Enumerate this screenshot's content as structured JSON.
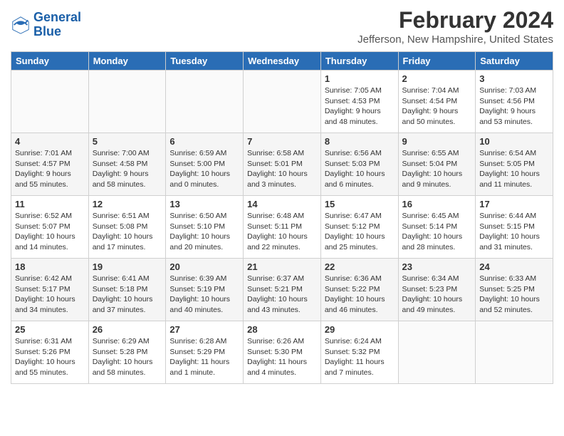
{
  "logo": {
    "line1": "General",
    "line2": "Blue"
  },
  "title": "February 2024",
  "subtitle": "Jefferson, New Hampshire, United States",
  "days_of_week": [
    "Sunday",
    "Monday",
    "Tuesday",
    "Wednesday",
    "Thursday",
    "Friday",
    "Saturday"
  ],
  "weeks": [
    [
      {
        "day": "",
        "info": ""
      },
      {
        "day": "",
        "info": ""
      },
      {
        "day": "",
        "info": ""
      },
      {
        "day": "",
        "info": ""
      },
      {
        "day": "1",
        "info": "Sunrise: 7:05 AM\nSunset: 4:53 PM\nDaylight: 9 hours\nand 48 minutes."
      },
      {
        "day": "2",
        "info": "Sunrise: 7:04 AM\nSunset: 4:54 PM\nDaylight: 9 hours\nand 50 minutes."
      },
      {
        "day": "3",
        "info": "Sunrise: 7:03 AM\nSunset: 4:56 PM\nDaylight: 9 hours\nand 53 minutes."
      }
    ],
    [
      {
        "day": "4",
        "info": "Sunrise: 7:01 AM\nSunset: 4:57 PM\nDaylight: 9 hours\nand 55 minutes."
      },
      {
        "day": "5",
        "info": "Sunrise: 7:00 AM\nSunset: 4:58 PM\nDaylight: 9 hours\nand 58 minutes."
      },
      {
        "day": "6",
        "info": "Sunrise: 6:59 AM\nSunset: 5:00 PM\nDaylight: 10 hours\nand 0 minutes."
      },
      {
        "day": "7",
        "info": "Sunrise: 6:58 AM\nSunset: 5:01 PM\nDaylight: 10 hours\nand 3 minutes."
      },
      {
        "day": "8",
        "info": "Sunrise: 6:56 AM\nSunset: 5:03 PM\nDaylight: 10 hours\nand 6 minutes."
      },
      {
        "day": "9",
        "info": "Sunrise: 6:55 AM\nSunset: 5:04 PM\nDaylight: 10 hours\nand 9 minutes."
      },
      {
        "day": "10",
        "info": "Sunrise: 6:54 AM\nSunset: 5:05 PM\nDaylight: 10 hours\nand 11 minutes."
      }
    ],
    [
      {
        "day": "11",
        "info": "Sunrise: 6:52 AM\nSunset: 5:07 PM\nDaylight: 10 hours\nand 14 minutes."
      },
      {
        "day": "12",
        "info": "Sunrise: 6:51 AM\nSunset: 5:08 PM\nDaylight: 10 hours\nand 17 minutes."
      },
      {
        "day": "13",
        "info": "Sunrise: 6:50 AM\nSunset: 5:10 PM\nDaylight: 10 hours\nand 20 minutes."
      },
      {
        "day": "14",
        "info": "Sunrise: 6:48 AM\nSunset: 5:11 PM\nDaylight: 10 hours\nand 22 minutes."
      },
      {
        "day": "15",
        "info": "Sunrise: 6:47 AM\nSunset: 5:12 PM\nDaylight: 10 hours\nand 25 minutes."
      },
      {
        "day": "16",
        "info": "Sunrise: 6:45 AM\nSunset: 5:14 PM\nDaylight: 10 hours\nand 28 minutes."
      },
      {
        "day": "17",
        "info": "Sunrise: 6:44 AM\nSunset: 5:15 PM\nDaylight: 10 hours\nand 31 minutes."
      }
    ],
    [
      {
        "day": "18",
        "info": "Sunrise: 6:42 AM\nSunset: 5:17 PM\nDaylight: 10 hours\nand 34 minutes."
      },
      {
        "day": "19",
        "info": "Sunrise: 6:41 AM\nSunset: 5:18 PM\nDaylight: 10 hours\nand 37 minutes."
      },
      {
        "day": "20",
        "info": "Sunrise: 6:39 AM\nSunset: 5:19 PM\nDaylight: 10 hours\nand 40 minutes."
      },
      {
        "day": "21",
        "info": "Sunrise: 6:37 AM\nSunset: 5:21 PM\nDaylight: 10 hours\nand 43 minutes."
      },
      {
        "day": "22",
        "info": "Sunrise: 6:36 AM\nSunset: 5:22 PM\nDaylight: 10 hours\nand 46 minutes."
      },
      {
        "day": "23",
        "info": "Sunrise: 6:34 AM\nSunset: 5:23 PM\nDaylight: 10 hours\nand 49 minutes."
      },
      {
        "day": "24",
        "info": "Sunrise: 6:33 AM\nSunset: 5:25 PM\nDaylight: 10 hours\nand 52 minutes."
      }
    ],
    [
      {
        "day": "25",
        "info": "Sunrise: 6:31 AM\nSunset: 5:26 PM\nDaylight: 10 hours\nand 55 minutes."
      },
      {
        "day": "26",
        "info": "Sunrise: 6:29 AM\nSunset: 5:28 PM\nDaylight: 10 hours\nand 58 minutes."
      },
      {
        "day": "27",
        "info": "Sunrise: 6:28 AM\nSunset: 5:29 PM\nDaylight: 11 hours\nand 1 minute."
      },
      {
        "day": "28",
        "info": "Sunrise: 6:26 AM\nSunset: 5:30 PM\nDaylight: 11 hours\nand 4 minutes."
      },
      {
        "day": "29",
        "info": "Sunrise: 6:24 AM\nSunset: 5:32 PM\nDaylight: 11 hours\nand 7 minutes."
      },
      {
        "day": "",
        "info": ""
      },
      {
        "day": "",
        "info": ""
      }
    ]
  ]
}
